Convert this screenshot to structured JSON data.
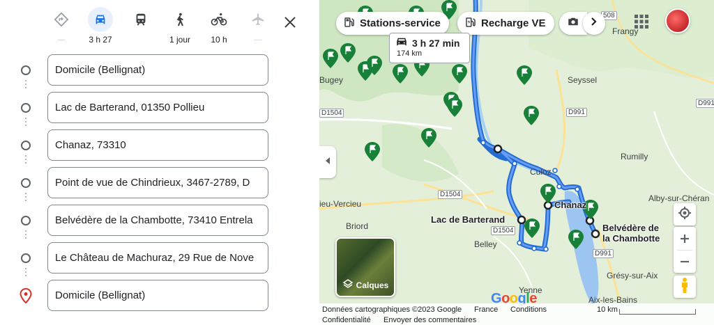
{
  "travel_modes": [
    {
      "name": "best",
      "label": ""
    },
    {
      "name": "car",
      "label": "3 h 27"
    },
    {
      "name": "transit",
      "label": ""
    },
    {
      "name": "walk",
      "label": "1 jour"
    },
    {
      "name": "bike",
      "label": "10 h"
    },
    {
      "name": "flight",
      "label": ""
    }
  ],
  "stops": [
    "Domicile (Bellignat)",
    "Lac de Barterand, 01350 Pollieu",
    "Chanaz, 73310",
    "Point de vue de Chindrieux, 3467-2789, D",
    "Belvédère de la Chambotte, 73410 Entrela",
    "Le Château de Machuraz, 29 Rue de Nove",
    "Domicile (Bellignat)"
  ],
  "chips": {
    "stations": "Stations-service",
    "recharge": "Recharge VE"
  },
  "route_info": {
    "duration": "3 h 27 min",
    "distance": "174 km"
  },
  "map_labels": {
    "frangy": "Frangy",
    "seyssel": "Seyssel",
    "bugey": "Bugey",
    "rumilly": "Rumilly",
    "culoz": "Culoz",
    "alby": "Alby-sur-Chéran",
    "vercieu": "ieu-Vercieu",
    "briord": "Briord",
    "belley": "Belley",
    "gresy": "Grésy-sur-Aix",
    "yenne": "Yenne",
    "aix": "Aix-les-Bains",
    "lac_barterand": "Lac de Barterand",
    "chanaz": "Chanaz",
    "belvedere": "Belvédère de\nla Chambotte"
  },
  "roads": {
    "d1504a": "D1504",
    "d1504b": "D1504",
    "d1504c": "D1504",
    "d991a": "D991",
    "d991b": "D991",
    "d991c": "D991",
    "r508": "508"
  },
  "layers_label": "Calques",
  "footer": {
    "data": "Données cartographiques ©2023 Google",
    "country": "France",
    "conditions": "Conditions",
    "privacy": "Confidentialité",
    "feedback": "Envoyer des commentaires",
    "scale": "10 km"
  },
  "google_logo": "Google"
}
